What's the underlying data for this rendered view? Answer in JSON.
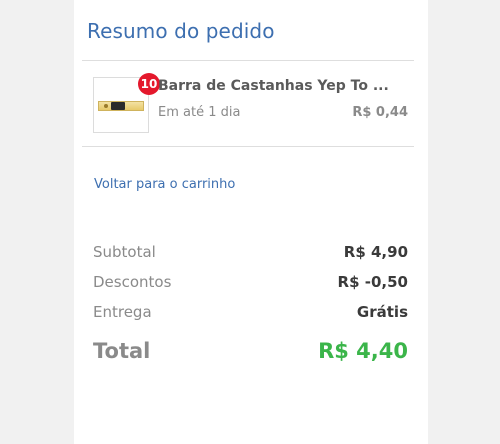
{
  "summary": {
    "title": "Resumo do pedido"
  },
  "cart_item": {
    "quantity": "10",
    "name": "Barra de Castanhas Yep To ...",
    "delivery": "Em até 1 dia",
    "price": "R$ 0,44"
  },
  "links": {
    "back_to_cart": "Voltar para o carrinho"
  },
  "totals": {
    "subtotal_label": "Subtotal",
    "subtotal_value": "R$ 4,90",
    "discounts_label": "Descontos",
    "discounts_value": "R$ -0,50",
    "delivery_label": "Entrega",
    "delivery_value": "Grátis",
    "total_label": "Total",
    "total_value": "R$ 4,40"
  },
  "colors": {
    "title_blue": "#3d6fb0",
    "badge_red": "#e4182c",
    "total_green": "#3bb54a"
  }
}
